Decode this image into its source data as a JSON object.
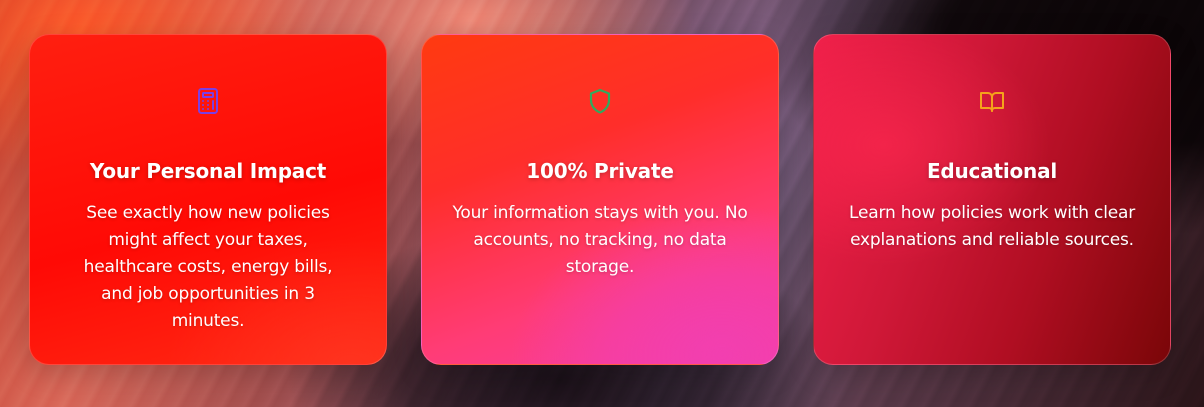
{
  "features": [
    {
      "icon": "calculator-icon",
      "icon_color": "#7b3fe4",
      "title": "Your Personal Impact",
      "text": "See exactly how new policies might affect your taxes, healthcare costs, energy bills, and job opportunities in 3 minutes."
    },
    {
      "icon": "shield-icon",
      "icon_color": "#2faa5e",
      "title": "100% Private",
      "text": "Your information stays with you. No accounts, no tracking, no data storage."
    },
    {
      "icon": "book-open-icon",
      "icon_color": "#f5a21b",
      "title": "Educational",
      "text": "Learn how policies work with clear explanations and reliable sources."
    }
  ]
}
